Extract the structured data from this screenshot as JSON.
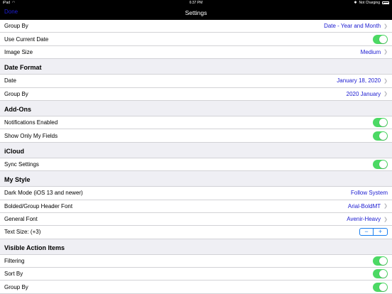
{
  "status": {
    "device": "iPad",
    "time": "6:37 PM",
    "battery_text": "Not Charging"
  },
  "nav": {
    "back_label": "Done",
    "title": "Settings"
  },
  "general": {
    "group_by_label": "Group By",
    "group_by_value": "Date - Year and Month",
    "use_current_date_label": "Use Current Date",
    "image_size_label": "Image Size",
    "image_size_value": "Medium"
  },
  "date_format": {
    "header": "Date Format",
    "date_label": "Date",
    "date_value": "January 18, 2020",
    "group_by_label": "Group By",
    "group_by_value": "2020 January"
  },
  "addons": {
    "header": "Add-Ons",
    "notifications_label": "Notifications Enabled",
    "show_only_label": "Show Only My Fields"
  },
  "icloud": {
    "header": "iCloud",
    "sync_label": "Sync Settings"
  },
  "my_style": {
    "header": "My Style",
    "dark_mode_label": "Dark Mode (iOS 13 and newer)",
    "dark_mode_value": "Follow System",
    "bold_font_label": "Bolded/Group Header Font",
    "bold_font_value": "Arial-BoldMT",
    "general_font_label": "General Font",
    "general_font_value": "Avenir-Heavy",
    "text_size_label": "Text Size: (+3)",
    "minus_label": "−",
    "plus_label": "+"
  },
  "visible_actions": {
    "header": "Visible Action Items",
    "filtering_label": "Filtering",
    "sort_by_label": "Sort By",
    "group_by_label": "Group By"
  },
  "colors": {
    "accent": "#1a1ad0",
    "toggle_on": "#4cd964",
    "nav_bg": "#000000"
  }
}
